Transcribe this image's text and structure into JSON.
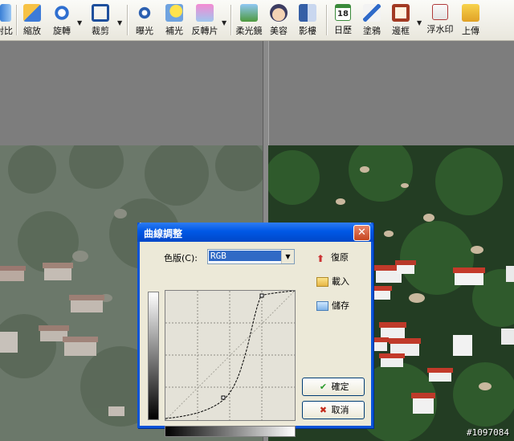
{
  "toolbar": {
    "items": [
      {
        "label": "對比",
        "icon": "contrast-icon"
      },
      {
        "label": "縮放",
        "icon": "resize-icon"
      },
      {
        "label": "旋轉",
        "icon": "rotate-icon"
      },
      {
        "label": "裁剪",
        "icon": "crop-icon"
      },
      {
        "label": "曝光",
        "icon": "exposure-icon"
      },
      {
        "label": "補光",
        "icon": "fill-light-icon"
      },
      {
        "label": "反轉片",
        "icon": "reversal-film-icon"
      },
      {
        "label": "柔光鏡",
        "icon": "soft-focus-icon"
      },
      {
        "label": "美容",
        "icon": "beauty-icon"
      },
      {
        "label": "影樓",
        "icon": "studio-icon"
      },
      {
        "label": "日歷",
        "icon": "calendar-icon"
      },
      {
        "label": "塗鴉",
        "icon": "doodle-icon"
      },
      {
        "label": "邊框",
        "icon": "frame-icon"
      },
      {
        "label": "浮水印",
        "icon": "watermark-icon"
      },
      {
        "label": "上傳",
        "icon": "upload-icon"
      }
    ],
    "calendar_day": "18"
  },
  "dialog": {
    "title": "曲線調整",
    "close_glyph": "✕",
    "channel_label": "色版(C):",
    "channel_value": "RGB",
    "reset_label": "復原",
    "load_label": "載入",
    "save_label": "儲存",
    "ok_label": "確定",
    "cancel_label": "取消"
  },
  "watermark_text": "#1097084",
  "colors": {
    "titlebar": "#0058e6",
    "dialog_bg": "#ece9d8",
    "select_highlight": "#316ac5"
  }
}
